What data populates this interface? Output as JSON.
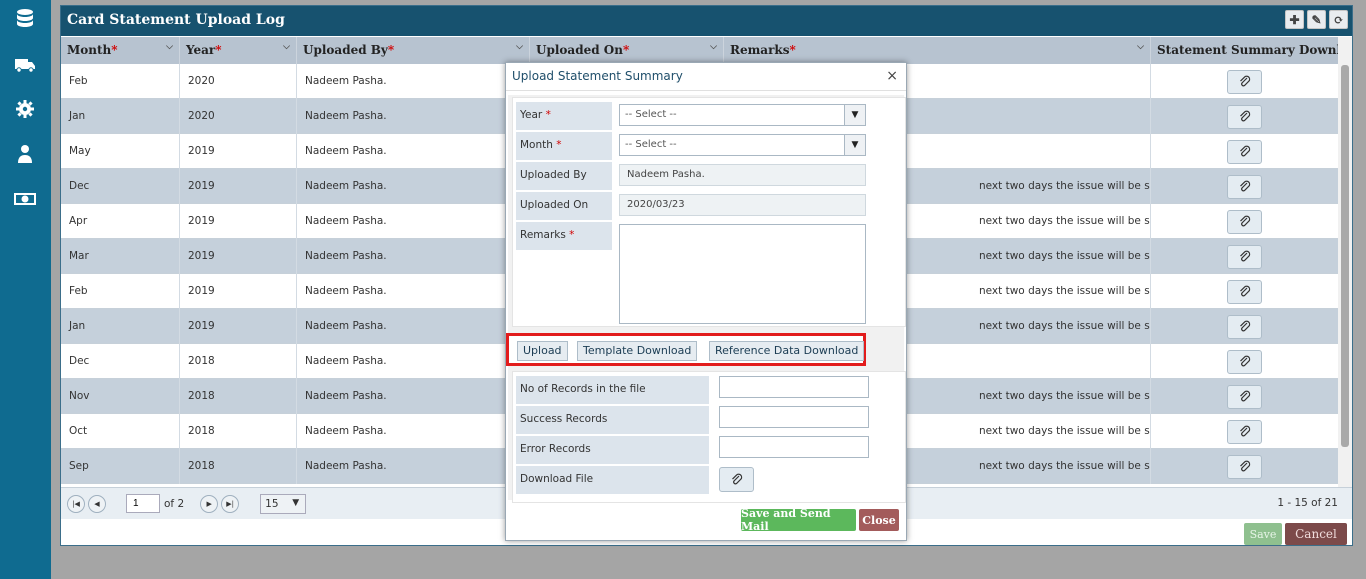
{
  "sidebar": {
    "icons": [
      "database-icon",
      "truck-icon",
      "gear-icon",
      "user-icon",
      "money-icon"
    ]
  },
  "panel": {
    "title": "Card Statement Upload Log",
    "tools": [
      "add-icon",
      "edit-icon",
      "refresh-icon"
    ]
  },
  "grid": {
    "columns": [
      {
        "label": "Month",
        "required": "*"
      },
      {
        "label": "Year",
        "required": "*"
      },
      {
        "label": "Uploaded By",
        "required": "*"
      },
      {
        "label": "Uploaded On",
        "required": "*"
      },
      {
        "label": "Remarks",
        "required": "*"
      },
      {
        "label": "Statement Summary Download",
        "required": ""
      }
    ],
    "rows": [
      {
        "month": "Feb",
        "year": "2020",
        "by": "Nadeem Pasha.",
        "remarks": ""
      },
      {
        "month": "Jan",
        "year": "2020",
        "by": "Nadeem Pasha.",
        "remarks": ""
      },
      {
        "month": "May",
        "year": "2019",
        "by": "Nadeem Pasha.",
        "remarks": ""
      },
      {
        "month": "Dec",
        "year": "2019",
        "by": "Nadeem Pasha.",
        "remarks": "next two days the issue will be sorted out"
      },
      {
        "month": "Apr",
        "year": "2019",
        "by": "Nadeem Pasha.",
        "remarks": "next two days the issue will be sorted out"
      },
      {
        "month": "Mar",
        "year": "2019",
        "by": "Nadeem Pasha.",
        "remarks": "next two days the issue will be sorted out"
      },
      {
        "month": "Feb",
        "year": "2019",
        "by": "Nadeem Pasha.",
        "remarks": "next two days the issue will be sorted out"
      },
      {
        "month": "Jan",
        "year": "2019",
        "by": "Nadeem Pasha.",
        "remarks": "next two days the issue will be sorted out"
      },
      {
        "month": "Dec",
        "year": "2018",
        "by": "Nadeem Pasha.",
        "remarks": ""
      },
      {
        "month": "Nov",
        "year": "2018",
        "by": "Nadeem Pasha.",
        "remarks": "next two days the issue will be sorted out"
      },
      {
        "month": "Oct",
        "year": "2018",
        "by": "Nadeem Pasha.",
        "remarks": "next two days the issue will be sorted out"
      },
      {
        "month": "Sep",
        "year": "2018",
        "by": "Nadeem Pasha.",
        "remarks": "next two days the issue will be sorted out"
      }
    ]
  },
  "pager": {
    "first": "|◀",
    "prev": "◀",
    "page": "1",
    "of_pages": "of 2",
    "next": "▶",
    "last": "▶|",
    "page_size": "15",
    "info": "1 - 15 of 21"
  },
  "footer": {
    "save": "Save",
    "cancel": "Cancel"
  },
  "modal": {
    "title": "Upload Statement Summary",
    "close": "×",
    "year_label": "Year",
    "month_label": "Month",
    "required": "*",
    "select_placeholder": "-- Select --",
    "uploaded_by_label": "Uploaded By",
    "uploaded_by_value": "Nadeem Pasha.",
    "uploaded_on_label": "Uploaded On",
    "uploaded_on_value": "2020/03/23",
    "remarks_label": "Remarks",
    "upload_btn": "Upload",
    "template_btn": "Template Download",
    "reference_btn": "Reference Data Download",
    "records_label": "No of Records in the file",
    "success_label": "Success Records",
    "error_label": "Error Records",
    "download_label": "Download File",
    "send_btn": "Save and Send Mail",
    "close_btn": "Close"
  },
  "colors": {
    "sidebar": "#0f6b90",
    "header": "#17526f",
    "highlight": "#e21c1c",
    "send": "#5cb85c",
    "close": "#a35b5b"
  }
}
